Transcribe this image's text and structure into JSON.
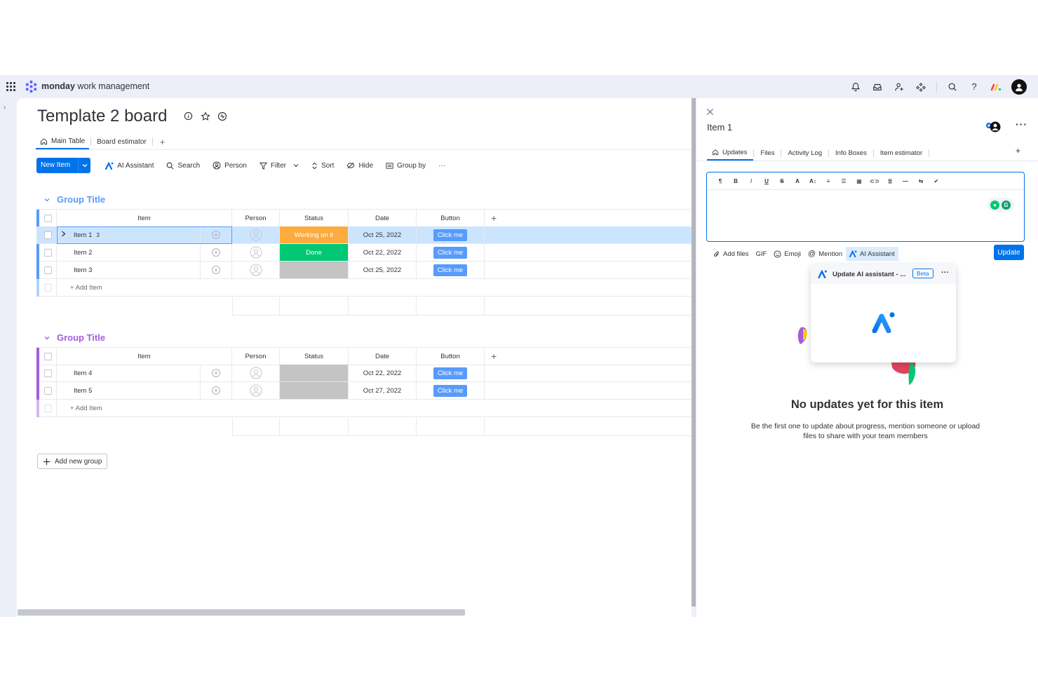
{
  "topbar": {
    "brand_bold": "monday",
    "brand_rest": " work management",
    "icons": [
      "bell-icon",
      "inbox-icon",
      "invite-icon",
      "apps-icon",
      "search-icon",
      "help-icon",
      "monday-logo-icon",
      "user-avatar"
    ]
  },
  "board": {
    "title": "Template 2 board",
    "tabs": [
      {
        "label": "Main Table",
        "active": true
      },
      {
        "label": "Board estimator",
        "active": false
      }
    ],
    "tab_add": "+",
    "toolbar": {
      "new_item": "New Item",
      "ai_assistant": "AI Assistant",
      "search": "Search",
      "person": "Person",
      "filter": "Filter",
      "sort": "Sort",
      "hide": "Hide",
      "group_by": "Group by",
      "more": "···"
    },
    "columns": {
      "item": "Item",
      "person": "Person",
      "status": "Status",
      "date": "Date",
      "button": "Button",
      "add": "+"
    },
    "groups": [
      {
        "title": "Group Title",
        "color": "#579bfc",
        "rows": [
          {
            "name": "Item 1",
            "subitems": "3",
            "status": "Working on it",
            "status_color": "#fdab3d",
            "date": "Oct 25, 2022",
            "button": "Click me",
            "selected": true
          },
          {
            "name": "Item 2",
            "subitems": "",
            "status": "Done",
            "status_color": "#00c875",
            "date": "Oct 22, 2022",
            "button": "Click me",
            "selected": false
          },
          {
            "name": "Item 3",
            "subitems": "",
            "status": "",
            "status_color": "#c4c4c4",
            "date": "Oct 25, 2022",
            "button": "Click me",
            "selected": false
          }
        ],
        "add_item": "+ Add Item"
      },
      {
        "title": "Group Title",
        "color": "#a25ddc",
        "rows": [
          {
            "name": "Item 4",
            "subitems": "",
            "status": "",
            "status_color": "#c4c4c4",
            "date": "Oct 22, 2022",
            "button": "Click me",
            "selected": false
          },
          {
            "name": "Item 5",
            "subitems": "",
            "status": "",
            "status_color": "#c4c4c4",
            "date": "Oct 27, 2022",
            "button": "Click me",
            "selected": false
          }
        ],
        "add_item": "+ Add Item"
      }
    ],
    "add_group": "Add new group"
  },
  "panel": {
    "title": "Item 1",
    "more": "···",
    "tabs": [
      "Updates",
      "Files",
      "Activity Log",
      "Info Boxes",
      "Item estimator"
    ],
    "tab_add": "+",
    "editor_tools": [
      "¶",
      "B",
      "I",
      "U",
      "S",
      "A",
      "A↕",
      "≡",
      "☰",
      "▦",
      "⊂⊃",
      "≣",
      "—",
      "⇆",
      "✔"
    ],
    "actions": {
      "add_files": "Add files",
      "gif": "GIF",
      "emoji": "Emoji",
      "mention": "Mention",
      "ai_assistant": "AI Assistant"
    },
    "update_button": "Update",
    "ai_popup": {
      "title": "Update AI assistant - ...",
      "badge": "Beta",
      "more": "···"
    },
    "empty_title": "No updates yet for this item",
    "empty_subtitle": "Be the first one to update about progress, mention someone or upload files to share with your team members"
  }
}
